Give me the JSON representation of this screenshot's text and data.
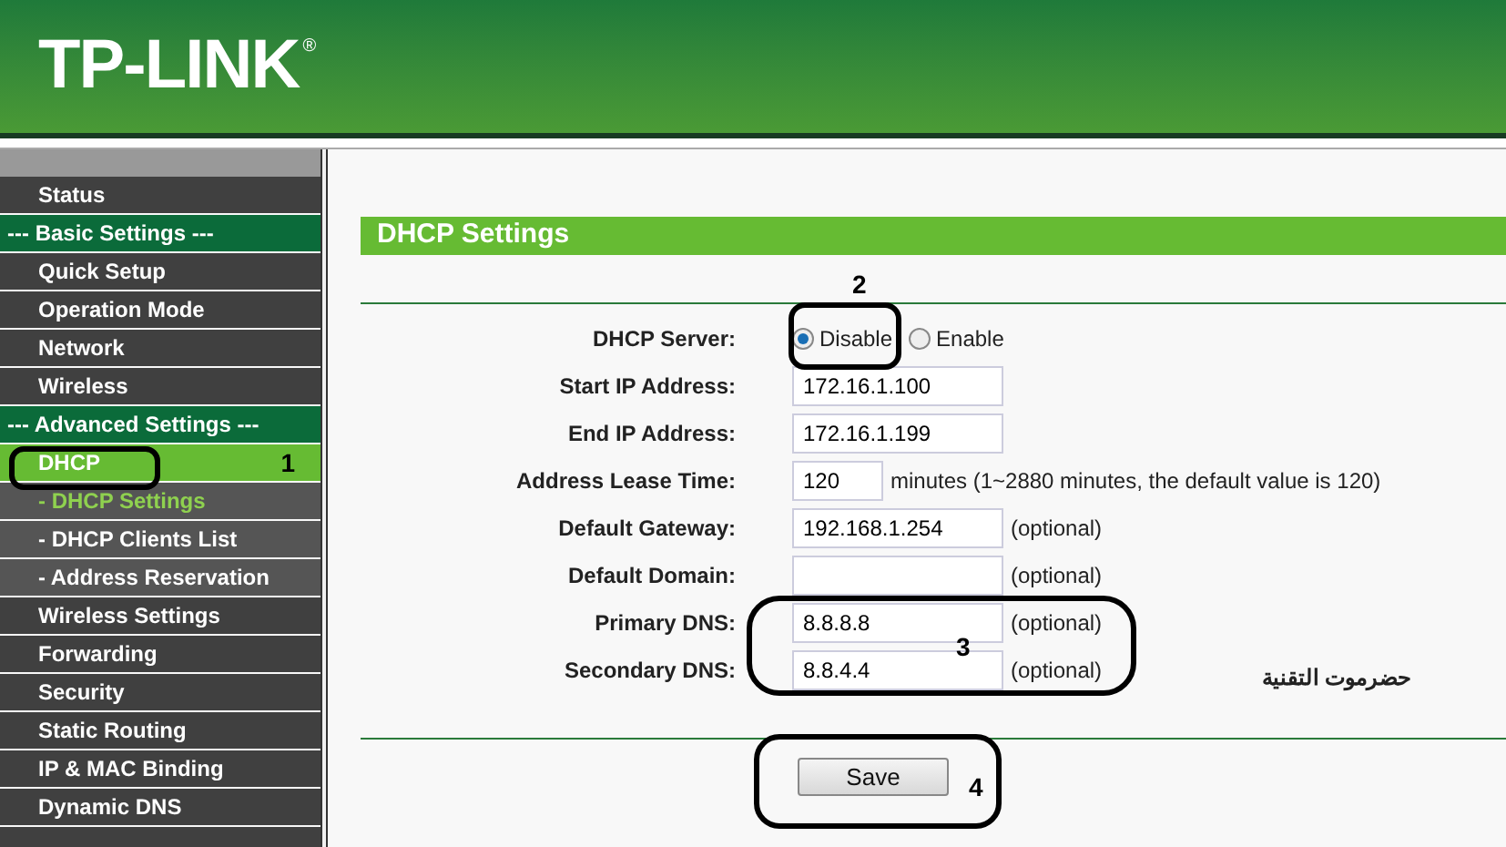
{
  "header": {
    "logo": "TP-LINK",
    "logo_mark": "®"
  },
  "sidebar": {
    "items": [
      {
        "label": "Status",
        "kind": "item",
        "selected": false
      },
      {
        "label": "--- Basic Settings ---",
        "kind": "header"
      },
      {
        "label": "Quick Setup",
        "kind": "item",
        "selected": false
      },
      {
        "label": "Operation Mode",
        "kind": "item",
        "selected": false
      },
      {
        "label": "Network",
        "kind": "item",
        "selected": false
      },
      {
        "label": "Wireless",
        "kind": "item",
        "selected": false
      },
      {
        "label": "--- Advanced Settings ---",
        "kind": "header"
      },
      {
        "label": "DHCP",
        "kind": "item",
        "selected": true
      },
      {
        "label": "- DHCP Settings",
        "kind": "subitem",
        "selected": true
      },
      {
        "label": "- DHCP Clients List",
        "kind": "subitem",
        "selected": false
      },
      {
        "label": "- Address Reservation",
        "kind": "subitem",
        "selected": false
      },
      {
        "label": "Wireless Settings",
        "kind": "item",
        "selected": false
      },
      {
        "label": "Forwarding",
        "kind": "item",
        "selected": false
      },
      {
        "label": "Security",
        "kind": "item",
        "selected": false
      },
      {
        "label": "Static Routing",
        "kind": "item",
        "selected": false
      },
      {
        "label": "IP & MAC Binding",
        "kind": "item",
        "selected": false
      },
      {
        "label": "Dynamic DNS",
        "kind": "item",
        "selected": false
      }
    ]
  },
  "panel": {
    "title": "DHCP Settings",
    "fields": [
      {
        "label": "DHCP Server:",
        "kind": "radio",
        "options": [
          {
            "label": "Disable",
            "selected": true
          },
          {
            "label": "Enable",
            "selected": false
          }
        ]
      },
      {
        "label": "Start IP Address:",
        "kind": "text",
        "value": "172.16.1.100"
      },
      {
        "label": "End IP Address:",
        "kind": "text",
        "value": "172.16.1.199"
      },
      {
        "label": "Address Lease Time:",
        "kind": "short",
        "value": "120",
        "note": "minutes (1~2880 minutes, the default value is 120)"
      },
      {
        "label": "Default Gateway:",
        "kind": "text",
        "value": "192.168.1.254",
        "note": "(optional)"
      },
      {
        "label": "Default Domain:",
        "kind": "text",
        "note": "(optional)"
      },
      {
        "label": "Primary DNS:",
        "kind": "text",
        "value": "8.8.8.8",
        "note": "(optional)"
      },
      {
        "label": "Secondary DNS:",
        "kind": "text",
        "value": "8.8.4.4",
        "note": "(optional)"
      }
    ],
    "save_button": "Save"
  },
  "annotations": {
    "numbers": [
      "1",
      "2",
      "3",
      "4"
    ],
    "caption": "حضرموت التقنية"
  }
}
